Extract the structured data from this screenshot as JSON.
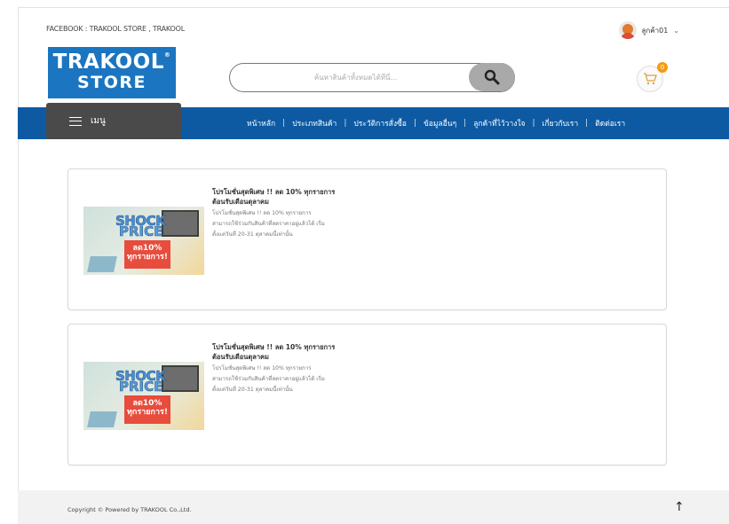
{
  "topbar": {
    "social_text": "FACEBOOK : TRAKOOL STORE , TRAKOOL",
    "user_label": "ลูกค้า01",
    "caret": "⌄"
  },
  "logo": {
    "line1": "TRAKOOL",
    "line2": "STORE",
    "reg_mark": "®"
  },
  "search": {
    "placeholder": "ค้นหาสินค้าทั้งหมดได้ที่นี่..."
  },
  "cart": {
    "count": "0"
  },
  "nav": {
    "menu_label": "เมนู",
    "links": [
      "หน้าหลัก",
      "ประเภทสินค้า",
      "ประวัติการสั่งซื้อ",
      "ข้อมูลอื่นๆ",
      "ลูกค้าที่ไว้วางใจ",
      "เกี่ยวกับเรา",
      "ติดต่อเรา"
    ]
  },
  "promotions": [
    {
      "title_line1": "โปรโมชั่นสุดพิเศษ !! ลด 10% ทุกรายการ",
      "title_line2": "ต้อนรับเดือนตุลาคม",
      "desc_line1": "โปรโมชั่นสุดพิเศษ !! ลด 10% ทุกรายการ",
      "desc_line2": "สามารถใช้ร่วมกับสินค้าที่ลดราคาอยู่แล้วได้ เริ่ม",
      "desc_line3": "ตั้งแต่วันที่ 20-31 ตุลาคมนี้เท่านั้น",
      "image_text_shock": "SHOCK",
      "image_text_price": "PRICE",
      "image_text_discount1": "ลด10%",
      "image_text_discount2": "ทุกรายการ!"
    },
    {
      "title_line1": "โปรโมชั่นสุดพิเศษ !! ลด 10% ทุกรายการ",
      "title_line2": "ต้อนรับเดือนตุลาคม",
      "desc_line1": "โปรโมชั่นสุดพิเศษ !! ลด 10% ทุกรายการ",
      "desc_line2": "สามารถใช้ร่วมกับสินค้าที่ลดราคาอยู่แล้วได้ เริ่ม",
      "desc_line3": "ตั้งแต่วันที่ 20-31 ตุลาคมนี้เท่านั้น",
      "image_text_shock": "SHOCK",
      "image_text_price": "PRICE",
      "image_text_discount1": "ลด10%",
      "image_text_discount2": "ทุกรายการ!"
    }
  ],
  "footer": {
    "copyright": "Copyright © Powered by TRAKOOL Co.,Ltd.",
    "back_to_top": "↑"
  },
  "colors": {
    "brand_blue": "#1b75c0",
    "nav_blue": "#0d5aa3",
    "menu_dark": "#4a4a4a",
    "badge_orange": "#f39c12"
  }
}
